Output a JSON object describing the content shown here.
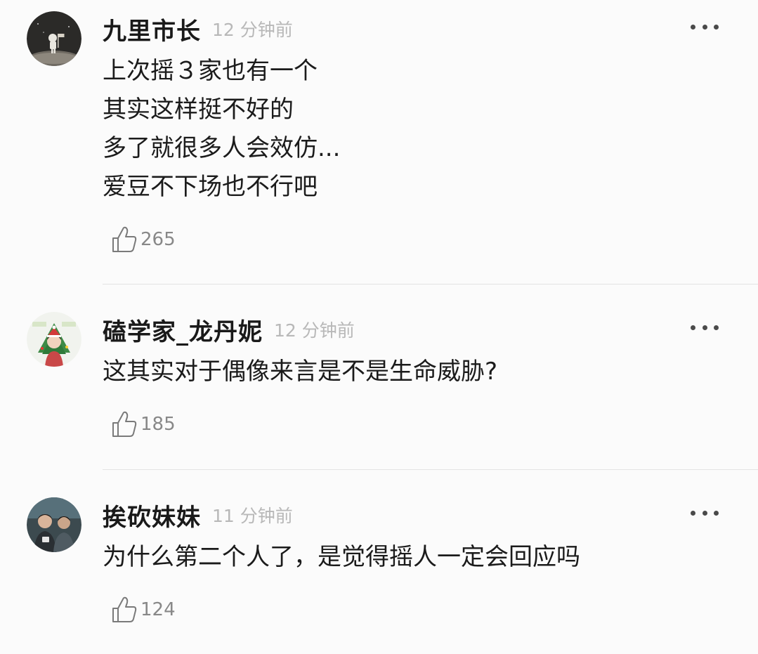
{
  "comments": [
    {
      "username": "九里市长",
      "time": "12 分钟前",
      "lines": [
        "上次摇３家也有一个",
        "其实这样挺不好的",
        "多了就很多人会效仿...",
        "爱豆不下场也不行吧"
      ],
      "likes": "265",
      "avatar_icon": "astronaut-moon-avatar"
    },
    {
      "username": "磕学家_龙丹妮",
      "time": "12 分钟前",
      "lines": [
        "这其实对于偶像来言是不是生命威胁?"
      ],
      "likes": "185",
      "avatar_icon": "christmas-tree-avatar"
    },
    {
      "username": "挨砍妹妹",
      "time": "11 分钟前",
      "lines": [
        "为什么第二个人了，是觉得摇人一定会回应吗"
      ],
      "likes": "124",
      "avatar_icon": "two-people-avatar"
    }
  ],
  "icons": {
    "more": "more-dots-icon",
    "like": "thumbs-up-outline-icon"
  },
  "colors": {
    "background": "#fbfbfb",
    "username": "#1a1a1a",
    "time": "#b8b8b8",
    "like_count": "#888888",
    "divider": "#e3e3e3"
  }
}
